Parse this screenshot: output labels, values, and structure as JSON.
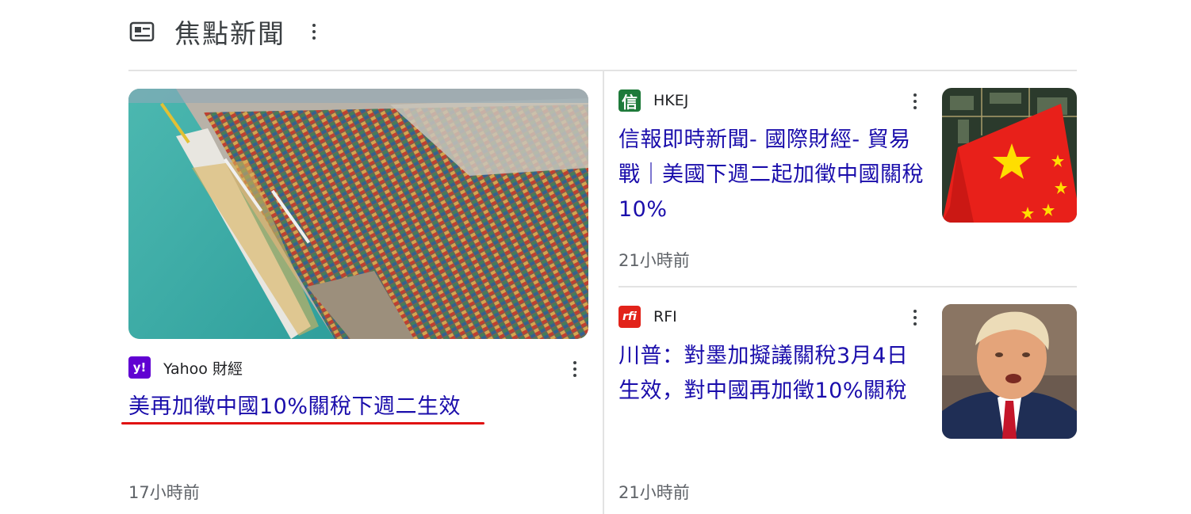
{
  "header": {
    "title": "焦點新聞",
    "icon": "news-icon",
    "menu_icon": "more-vert-icon"
  },
  "articles": [
    {
      "source": "Yahoo 財經",
      "logo_text": "y!",
      "logo_color": "#6001d2",
      "headline": "美再加徵中國10%關稅下週二生效",
      "time": "17小時前",
      "image": "container-port-aerial-photo"
    },
    {
      "source": "HKEJ",
      "logo_text": "信",
      "logo_color": "#1e7a3a",
      "headline": "信報即時新聞- 國際財經- 貿易戰｜美國下週二起加徵中國關稅10%",
      "time": "21小時前",
      "image": "china-flag-circuit-board-photo"
    },
    {
      "source": "RFI",
      "logo_text": "rfi",
      "logo_color": "#e2231a",
      "headline": "川普：對墨加擬議關稅3月4日生效，對中國再加徵10%關稅",
      "time": "21小時前",
      "image": "trump-portrait-photo"
    }
  ],
  "colors": {
    "link": "#1a0dab",
    "meta": "#5f6368",
    "divider": "#e3e3e3",
    "highlight_underline": "#e01111"
  }
}
